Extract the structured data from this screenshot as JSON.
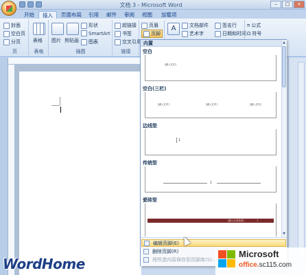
{
  "window": {
    "title": "文档 3 - Microsoft Word",
    "controls": [
      "–",
      "□",
      "×"
    ]
  },
  "tabs": [
    "开始",
    "插入",
    "页面布局",
    "引用",
    "邮件",
    "审阅",
    "视图",
    "加载项"
  ],
  "active_tab": "插入",
  "ribbon": {
    "pages_group": {
      "label": "页",
      "items": [
        "封面",
        "空白页",
        "分页"
      ]
    },
    "tables_group": {
      "label": "表格",
      "item": "表格"
    },
    "illustrations_group": {
      "label": "插图",
      "items": [
        "图片",
        "剪贴画",
        "形状",
        "SmartArt",
        "图表"
      ]
    },
    "links_group": {
      "label": "链接",
      "items": [
        "超链接",
        "书签",
        "交叉引用"
      ]
    },
    "header_group": {
      "items": [
        "页眉",
        "页脚"
      ]
    },
    "text_group": {
      "items": [
        "A",
        "文档部件",
        "艺术字",
        "签名行",
        "日期和时间"
      ]
    },
    "symbols_group": {
      "items": [
        "公式",
        "符号"
      ]
    }
  },
  "dropdown": {
    "header": "内置",
    "sections": [
      {
        "label": "空白",
        "placeholders": [
          "[键入文字]"
        ]
      },
      {
        "label": "空白(三栏)",
        "placeholders": [
          "[键入文字]",
          "[键入文字]",
          "[键入文字]"
        ]
      },
      {
        "label": "边线型",
        "placeholders": [
          "1"
        ]
      },
      {
        "label": "传统型",
        "placeholders": [
          "1"
        ]
      },
      {
        "label": "瓷砖型",
        "placeholders": [
          "[键入公司名称]",
          "1"
        ]
      }
    ],
    "menu": [
      {
        "label": "编辑页脚(E)",
        "state": "hover"
      },
      {
        "label": "删除页脚(R)",
        "state": "normal"
      },
      {
        "label": "将所选内容保存到页脚库(S)...",
        "state": "disabled"
      }
    ]
  },
  "watermarks": {
    "left": "WordHome",
    "right_title": "Microsoft",
    "right_site_prefix": "office.",
    "right_site_suffix": "sc115.com"
  },
  "colors": {
    "ms_red": "#f25022",
    "ms_green": "#7fba00",
    "ms_blue": "#00a4ef",
    "ms_yellow": "#ffb900"
  }
}
